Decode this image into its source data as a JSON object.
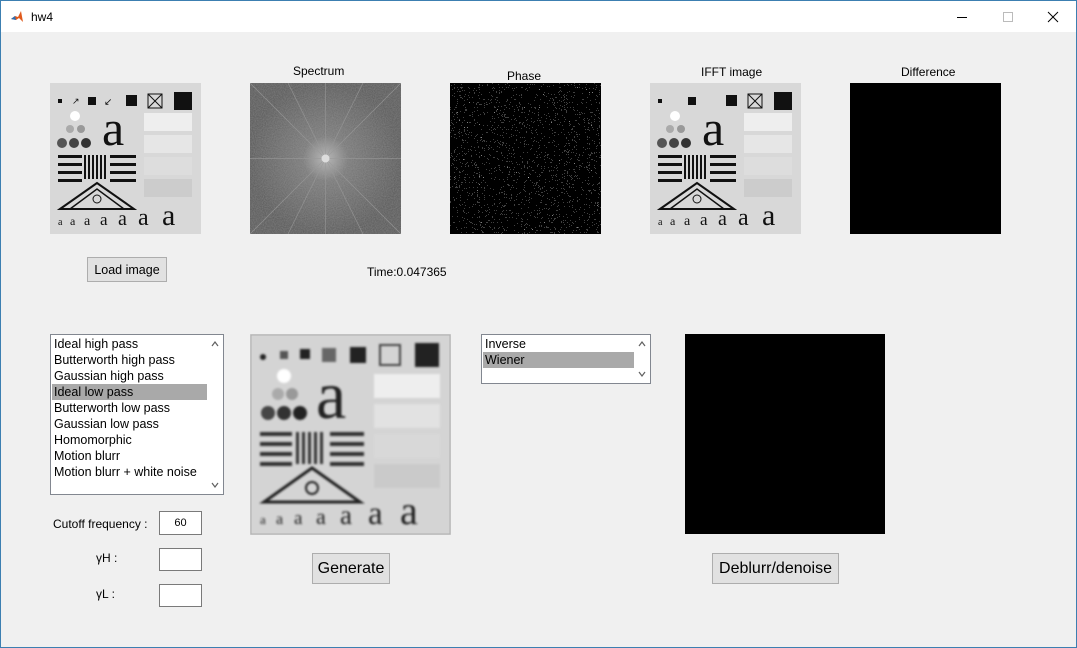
{
  "window": {
    "title": "hw4",
    "controls": {
      "minimize_icon": "minimize-icon",
      "maximize_icon": "maximize-icon",
      "close_icon": "close-icon"
    }
  },
  "images": {
    "spectrum_title": "Spectrum",
    "phase_title": "Phase",
    "ifft_title": "IFFT image",
    "difference_title": "Difference"
  },
  "load_button": "Load image",
  "time_text": "Time:0.047365",
  "filter_list": {
    "items": [
      "Ideal high pass",
      "Butterworth high pass",
      "Gaussian high pass",
      "Ideal low pass",
      "Butterworth low pass",
      "Gaussian low pass",
      "Homomorphic",
      "Motion blurr",
      "Motion blurr + white noise"
    ],
    "selected": "Ideal low pass"
  },
  "params": {
    "cutoff_label": "Cutoff frequency :",
    "cutoff_value": "60",
    "gamma_h_label": "γH :",
    "gamma_h_value": "",
    "gamma_l_label": "γL :",
    "gamma_l_value": ""
  },
  "generate_button": "Generate",
  "restore_list": {
    "items": [
      "Inverse",
      "Wiener"
    ],
    "selected": "Wiener"
  },
  "deblur_button": "Deblurr/denoise",
  "colors": {
    "selection": "#a9a9a9",
    "window_border": "#3c7fb1",
    "background": "#f0f0f0"
  }
}
